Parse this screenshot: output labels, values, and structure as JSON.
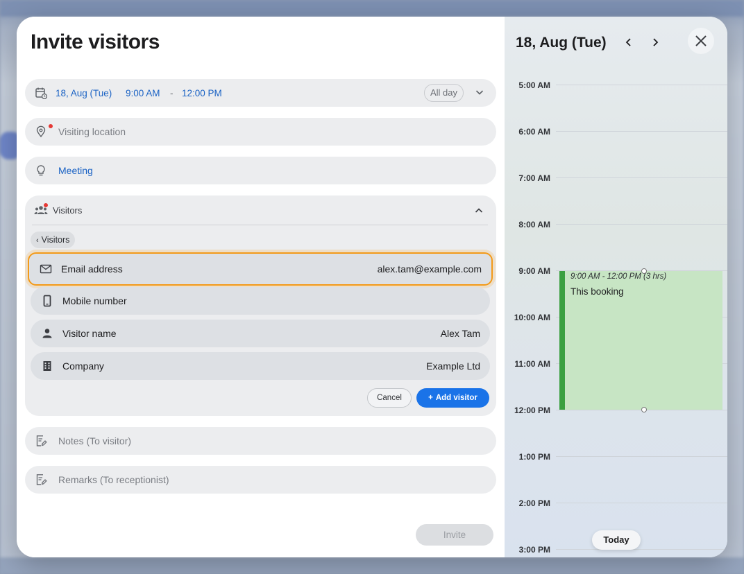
{
  "dialog": {
    "title": "Invite visitors",
    "date_row": {
      "date": "18, Aug (Tue)",
      "start_time": "9:00 AM",
      "separator": "-",
      "end_time": "12:00 PM",
      "all_day_label": "All day"
    },
    "location_placeholder": "Visiting location",
    "purpose_value": "Meeting",
    "visitors_section": {
      "label": "Visitors",
      "breadcrumb": "Visitors",
      "fields": [
        {
          "label": "Email address",
          "value": "alex.tam@example.com",
          "icon": "mail-icon"
        },
        {
          "label": "Mobile number",
          "value": "",
          "icon": "phone-icon"
        },
        {
          "label": "Visitor name",
          "value": "Alex Tam",
          "icon": "person-icon"
        },
        {
          "label": "Company",
          "value": "Example Ltd",
          "icon": "building-icon"
        }
      ],
      "cancel_label": "Cancel",
      "add_label": "Add visitor"
    },
    "notes_placeholder": "Notes (To visitor)",
    "remarks_placeholder": "Remarks (To receptionist)",
    "invite_label": "Invite"
  },
  "calendar": {
    "date": "18, Aug (Tue)",
    "hours": [
      "5:00 AM",
      "6:00 AM",
      "7:00 AM",
      "8:00 AM",
      "9:00 AM",
      "10:00 AM",
      "11:00 AM",
      "12:00 PM",
      "1:00 PM",
      "2:00 PM",
      "3:00 PM"
    ],
    "booking": {
      "time": "9:00 AM - 12:00 PM (3 hrs)",
      "name": "This booking",
      "color": "#c7e5c4",
      "accent": "#3aa040"
    },
    "today_label": "Today"
  },
  "colors": {
    "accent_blue": "#1a73e8",
    "focus_orange": "#f39a18",
    "required_dot": "#e53935"
  }
}
